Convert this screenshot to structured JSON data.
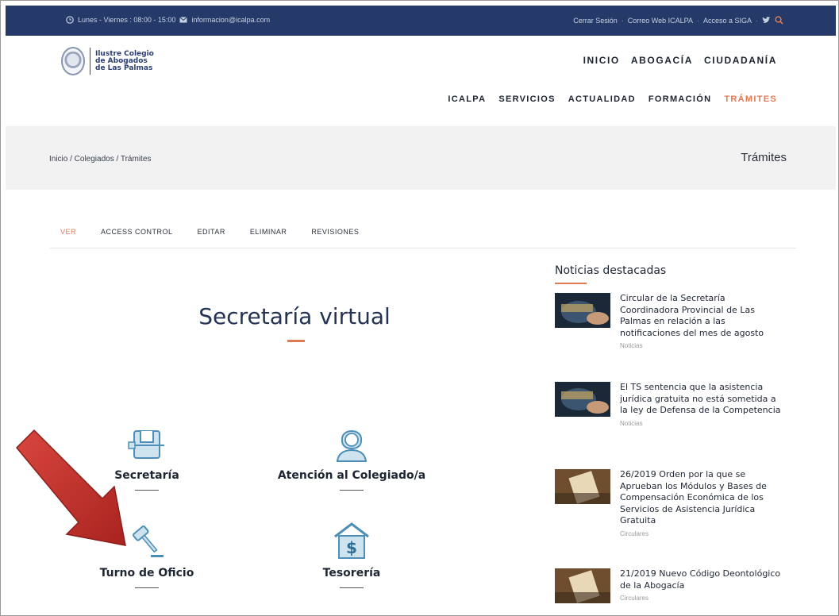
{
  "topbar": {
    "hours": "Lunes - Viernes : 08:00 - 15:00",
    "email": "informacion@icalpa.com",
    "links": [
      "Cerrar Sesión",
      "Correo Web ICALPA",
      "Acceso a SIGA"
    ]
  },
  "logo": {
    "line1": "Ilustre Colegio",
    "line2": "de Abogados",
    "line3": "de Las Palmas"
  },
  "nav_primary": [
    "INICIO",
    "ABOGACÍA",
    "CIUDADANÍA"
  ],
  "nav_secondary": [
    "ICALPA",
    "SERVICIOS",
    "ACTUALIDAD",
    "FORMACIÓN",
    "TRÁMITES"
  ],
  "breadcrumb": "Inicio / Colegiados / Trámites",
  "page_title": "Trámites",
  "tabs": [
    "VER",
    "ACCESS CONTROL",
    "EDITAR",
    "ELIMINAR",
    "REVISIONES"
  ],
  "main_title": "Secretaría virtual",
  "services": [
    {
      "label": "Secretaría",
      "icon": "printer-icon"
    },
    {
      "label": "Atención al Colegiado/a",
      "icon": "person-icon"
    },
    {
      "label": "Turno de Oficio",
      "icon": "gavel-icon"
    },
    {
      "label": "Tesorería",
      "icon": "dollar-house-icon"
    }
  ],
  "sidebar": {
    "heading": "Noticias destacadas",
    "news": [
      {
        "title": "Circular de la Secretaría Coordinadora Provincial de Las Palmas en relación a las notificaciones del mes de agosto",
        "category": "Noticias"
      },
      {
        "title": "El TS sentencia que la asistencia jurídica gratuita no está sometida a la ley de Defensa de la Competencia",
        "category": "Noticias"
      },
      {
        "title": "26/2019 Orden por la que se Aprueban los Módulos y Bases de Compensación Económica de los Servicios de Asistencia Jurídica Gratuita",
        "category": "Circulares"
      },
      {
        "title": "21/2019 Nuevo Código Deontológico de la Abogacía",
        "category": "Circulares"
      }
    ]
  },
  "colors": {
    "topbar": "#253a68",
    "accent": "#e07a52",
    "icon": "#4d8fb7"
  }
}
